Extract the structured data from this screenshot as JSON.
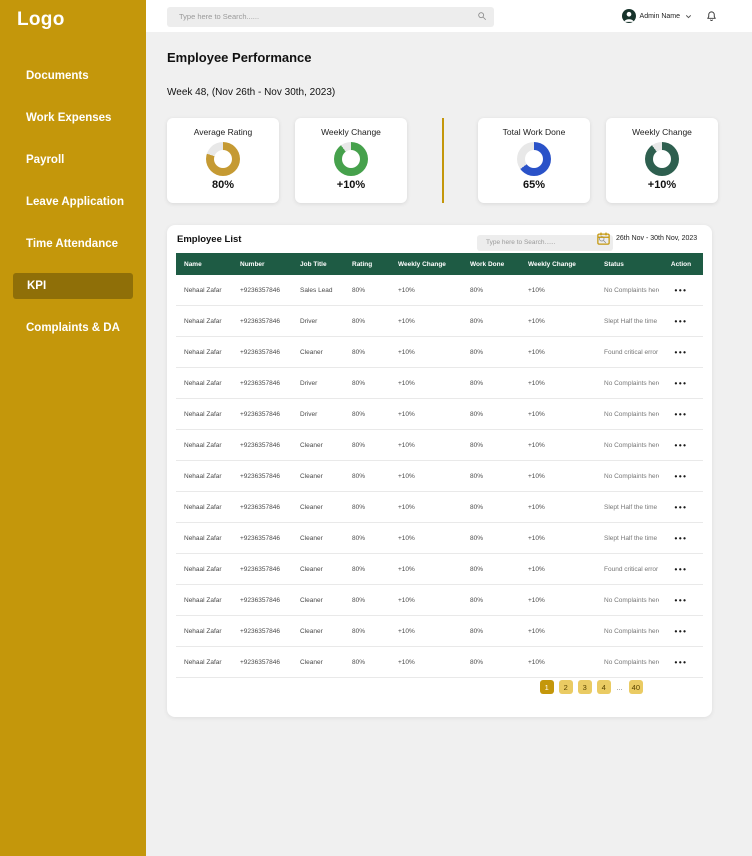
{
  "sidebar": {
    "logo": "Logo",
    "items": [
      {
        "label": "Documents",
        "active": false
      },
      {
        "label": "Work Expenses",
        "active": false
      },
      {
        "label": "Payroll",
        "active": false
      },
      {
        "label": "Leave Application",
        "active": false
      },
      {
        "label": "Time Attendance",
        "active": false
      },
      {
        "label": "KPI",
        "active": true
      },
      {
        "label": "Complaints & DA",
        "active": false
      }
    ]
  },
  "topbar": {
    "search_placeholder": "Type here to Search......",
    "user_name": "Admin Name"
  },
  "page": {
    "title": "Employee Performance",
    "subtitle": "Week 48, (Nov 26th - Nov 30th, 2023)"
  },
  "chart_data": [
    {
      "type": "pie",
      "title": "Average Rating",
      "value_label": "80%",
      "percent": 80,
      "color": "#C59A33"
    },
    {
      "type": "pie",
      "title": "Weekly Change",
      "value_label": "+10%",
      "percent": 90,
      "color": "#46A14C"
    },
    {
      "type": "pie",
      "title": "Total Work Done",
      "value_label": "65%",
      "percent": 65,
      "color": "#2A52C8"
    },
    {
      "type": "pie",
      "title": "Weekly Change",
      "value_label": "+10%",
      "percent": 90,
      "color": "#2E5F4F"
    }
  ],
  "employee_list": {
    "title": "Employee List",
    "search_placeholder": "Type here to Search......",
    "date_range": "26th Nov - 30th Nov, 2023",
    "columns": [
      "Name",
      "Number",
      "Job Title",
      "Rating",
      "Weekly Change",
      "Work Done",
      "Weekly Change",
      "Status",
      "Action"
    ],
    "actions_label": "•••",
    "rows": [
      {
        "name": "Nehaal Zafar",
        "number": "+9236357846",
        "job_title": "Sales Lead",
        "rating": "80%",
        "weekly_change": "+10%",
        "work_done": "80%",
        "weekly_change_2": "+10%",
        "status": "No Complaints here"
      },
      {
        "name": "Nehaal Zafar",
        "number": "+9236357846",
        "job_title": "Driver",
        "rating": "80%",
        "weekly_change": "+10%",
        "work_done": "80%",
        "weekly_change_2": "+10%",
        "status": "Slept Half the time"
      },
      {
        "name": "Nehaal Zafar",
        "number": "+9236357846",
        "job_title": "Cleaner",
        "rating": "80%",
        "weekly_change": "+10%",
        "work_done": "80%",
        "weekly_change_2": "+10%",
        "status": "Found critical error"
      },
      {
        "name": "Nehaal Zafar",
        "number": "+9236357846",
        "job_title": "Driver",
        "rating": "80%",
        "weekly_change": "+10%",
        "work_done": "80%",
        "weekly_change_2": "+10%",
        "status": "No Complaints here"
      },
      {
        "name": "Nehaal Zafar",
        "number": "+9236357846",
        "job_title": "Driver",
        "rating": "80%",
        "weekly_change": "+10%",
        "work_done": "80%",
        "weekly_change_2": "+10%",
        "status": "No Complaints here"
      },
      {
        "name": "Nehaal Zafar",
        "number": "+9236357846",
        "job_title": "Cleaner",
        "rating": "80%",
        "weekly_change": "+10%",
        "work_done": "80%",
        "weekly_change_2": "+10%",
        "status": "No Complaints here"
      },
      {
        "name": "Nehaal Zafar",
        "number": "+9236357846",
        "job_title": "Cleaner",
        "rating": "80%",
        "weekly_change": "+10%",
        "work_done": "80%",
        "weekly_change_2": "+10%",
        "status": "No Complaints here"
      },
      {
        "name": "Nehaal Zafar",
        "number": "+9236357846",
        "job_title": "Cleaner",
        "rating": "80%",
        "weekly_change": "+10%",
        "work_done": "80%",
        "weekly_change_2": "+10%",
        "status": "Slept Half the time"
      },
      {
        "name": "Nehaal Zafar",
        "number": "+9236357846",
        "job_title": "Cleaner",
        "rating": "80%",
        "weekly_change": "+10%",
        "work_done": "80%",
        "weekly_change_2": "+10%",
        "status": "Slept Half the time"
      },
      {
        "name": "Nehaal Zafar",
        "number": "+9236357846",
        "job_title": "Cleaner",
        "rating": "80%",
        "weekly_change": "+10%",
        "work_done": "80%",
        "weekly_change_2": "+10%",
        "status": "Found critical error"
      },
      {
        "name": "Nehaal Zafar",
        "number": "+9236357846",
        "job_title": "Cleaner",
        "rating": "80%",
        "weekly_change": "+10%",
        "work_done": "80%",
        "weekly_change_2": "+10%",
        "status": "No Complaints here"
      },
      {
        "name": "Nehaal Zafar",
        "number": "+9236357846",
        "job_title": "Cleaner",
        "rating": "80%",
        "weekly_change": "+10%",
        "work_done": "80%",
        "weekly_change_2": "+10%",
        "status": "No Complaints here"
      },
      {
        "name": "Nehaal Zafar",
        "number": "+9236357846",
        "job_title": "Cleaner",
        "rating": "80%",
        "weekly_change": "+10%",
        "work_done": "80%",
        "weekly_change_2": "+10%",
        "status": "No Complaints here"
      }
    ]
  },
  "pagination": {
    "items": [
      {
        "label": "1",
        "active": true,
        "ellipsis": false
      },
      {
        "label": "2",
        "active": false,
        "ellipsis": false
      },
      {
        "label": "3",
        "active": false,
        "ellipsis": false
      },
      {
        "label": "4",
        "active": false,
        "ellipsis": false
      },
      {
        "label": "...",
        "active": false,
        "ellipsis": true
      },
      {
        "label": "40",
        "active": false,
        "ellipsis": false
      }
    ]
  }
}
